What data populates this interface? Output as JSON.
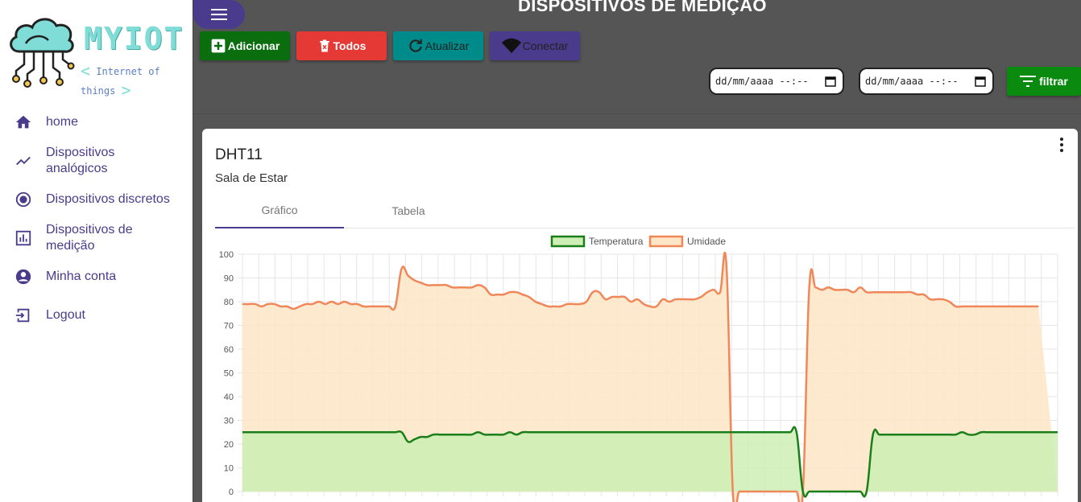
{
  "brand": {
    "title": "MYIOT",
    "subtitle": "Internet of things"
  },
  "sidebar": {
    "items": [
      {
        "label": "home",
        "icon": "home-icon"
      },
      {
        "label": "Dispositivos analógicos",
        "icon": "trending-up-icon"
      },
      {
        "label": "Dispositivos discretos",
        "icon": "radio-button-icon"
      },
      {
        "label": "Dispositivos de medição",
        "icon": "bar-chart-icon"
      },
      {
        "label": "Minha conta",
        "icon": "account-circle-icon"
      },
      {
        "label": "Logout",
        "icon": "logout-icon"
      }
    ]
  },
  "header": {
    "title": "DISPOSITIVOS DE MEDIÇÃO"
  },
  "toolbar": {
    "add_label": "Adicionar",
    "all_label": "Todos",
    "refresh_label": "Atualizar",
    "connect_label": "Conectar"
  },
  "filter": {
    "start_placeholder": "dd/mm/aaaa --:--",
    "end_placeholder": "dd/mm/aaaa --:--",
    "button_label": "filtrar"
  },
  "card": {
    "title": "DHT11",
    "subtitle": "Sala de Estar",
    "tabs": [
      "Gráfico",
      "Tabela"
    ],
    "active_tab": 0
  },
  "colors": {
    "primary": "#4a3b8c",
    "add": "#0a6e0e",
    "delete": "#e53935",
    "refresh": "#008b8b",
    "filter": "#0a8a0e",
    "temperature_line": "#1a7f1a",
    "temperature_fill": "#cdeeb4",
    "humidity_line": "#f0875a",
    "humidity_fill": "#fde6c6"
  },
  "chart_data": {
    "type": "area",
    "ylim": [
      0,
      100
    ],
    "yticks": [
      0,
      10,
      20,
      30,
      40,
      50,
      60,
      70,
      80,
      90,
      100
    ],
    "legend_position": "top-center",
    "grid": true,
    "series": [
      {
        "name": "Temperatura",
        "values": [
          25,
          25,
          25,
          25,
          25,
          25,
          25,
          25,
          25,
          25,
          25,
          25,
          25,
          25,
          25,
          25,
          25,
          25,
          25,
          25,
          25,
          25,
          25,
          25,
          25,
          25,
          21,
          22,
          23,
          23,
          24,
          24,
          24,
          24,
          24,
          24,
          24,
          25,
          24,
          24,
          24,
          24,
          25,
          24,
          25,
          25,
          25,
          25,
          25,
          25,
          25,
          25,
          25,
          25,
          25,
          25,
          25,
          25,
          25,
          25,
          25,
          25,
          25,
          25,
          25,
          25,
          25,
          25,
          25,
          25,
          25,
          25,
          25,
          25,
          25,
          25,
          25,
          25,
          25,
          25,
          25,
          25,
          25,
          25,
          25,
          25,
          25,
          25,
          0,
          0,
          0,
          0,
          0,
          0,
          0,
          0,
          0,
          0,
          0,
          24,
          24,
          24,
          24,
          24,
          24,
          24,
          24,
          24,
          24,
          24,
          24,
          24,
          24,
          25,
          24,
          24,
          25,
          25,
          25,
          25,
          25,
          25,
          25,
          25,
          25,
          25,
          25,
          25,
          25
        ]
      },
      {
        "name": "Umidade",
        "values": [
          79,
          79,
          79,
          78,
          79,
          79,
          78,
          78,
          77,
          78,
          79,
          79,
          80,
          79,
          80,
          79,
          80,
          79,
          79,
          78,
          78,
          78,
          78,
          78,
          78,
          94,
          91,
          89,
          88,
          87,
          87,
          87,
          87,
          86,
          86,
          86,
          86,
          87,
          86,
          83,
          83,
          83,
          84,
          84,
          83,
          82,
          80,
          79,
          78,
          78,
          78,
          79,
          79,
          79,
          80,
          84,
          84,
          81,
          82,
          82,
          82,
          80,
          81,
          79,
          78,
          78,
          81,
          80,
          81,
          81,
          81,
          81,
          82,
          84,
          85,
          84,
          95,
          0,
          0,
          0,
          0,
          0,
          0,
          0,
          0,
          0,
          0,
          0,
          0,
          86,
          86,
          85,
          86,
          85,
          85,
          85,
          84,
          86,
          84,
          84,
          84,
          84,
          84,
          84,
          84,
          84,
          83,
          83,
          81,
          81,
          81,
          80,
          78,
          78,
          78,
          78,
          78,
          78,
          78,
          78,
          78,
          78,
          78,
          78,
          78,
          78
        ]
      }
    ]
  }
}
